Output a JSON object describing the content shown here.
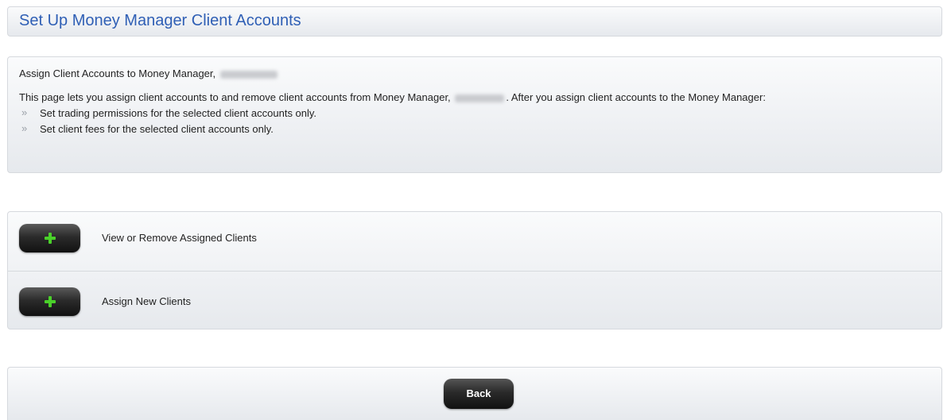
{
  "header": {
    "title": "Set Up Money Manager Client Accounts"
  },
  "info": {
    "heading": "Assign Client Accounts to Money Manager,",
    "description_part1": "This page lets you assign client accounts to and remove client accounts from Money Manager,",
    "description_part2": ". After you assign client accounts to the Money Manager:",
    "bullets": [
      "Set trading permissions for the selected client accounts only.",
      "Set client fees for the selected client accounts only."
    ],
    "bullet_glyph": "»"
  },
  "actions": {
    "items": [
      {
        "label": "View or Remove Assigned Clients",
        "icon": "plus-icon"
      },
      {
        "label": "Assign New Clients",
        "icon": "plus-icon"
      }
    ]
  },
  "footer": {
    "back_label": "Back"
  },
  "colors": {
    "title": "#2f5fb5",
    "plus": "#4ad12a",
    "button": "#1a1a1a"
  }
}
